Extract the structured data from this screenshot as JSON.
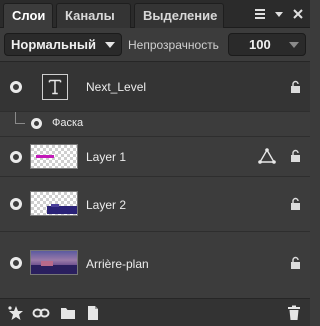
{
  "tabs": [
    {
      "label": "Слои",
      "active": true
    },
    {
      "label": "Каналы",
      "active": false
    },
    {
      "label": "Выделение",
      "active": false
    }
  ],
  "tab_icons": [
    "menu-icon",
    "dropdown-arrow-icon",
    "close-icon"
  ],
  "blend": {
    "mode": "Нормальный",
    "opacity_label": "Непрозрачность",
    "opacity_value": "100"
  },
  "layers": [
    {
      "name": "Next_Level",
      "type": "text",
      "thumb_icon": "text-layer-icon",
      "locked": true
    },
    {
      "name": "Фаска",
      "type": "effect"
    },
    {
      "name": "Layer 1",
      "type": "raster",
      "has_vector_icon": true,
      "locked": true
    },
    {
      "name": "Layer 2",
      "type": "raster",
      "locked": true
    },
    {
      "name": "Arrière-plan",
      "type": "background",
      "locked": true
    }
  ],
  "footer_icons": [
    "new-layer-star-icon",
    "link-icon",
    "folder-icon",
    "new-page-icon",
    "trash-icon"
  ],
  "colors": {
    "panel": "#3c3c3c",
    "tabbar": "#2b2b2b",
    "text": "#e6e6e6"
  }
}
